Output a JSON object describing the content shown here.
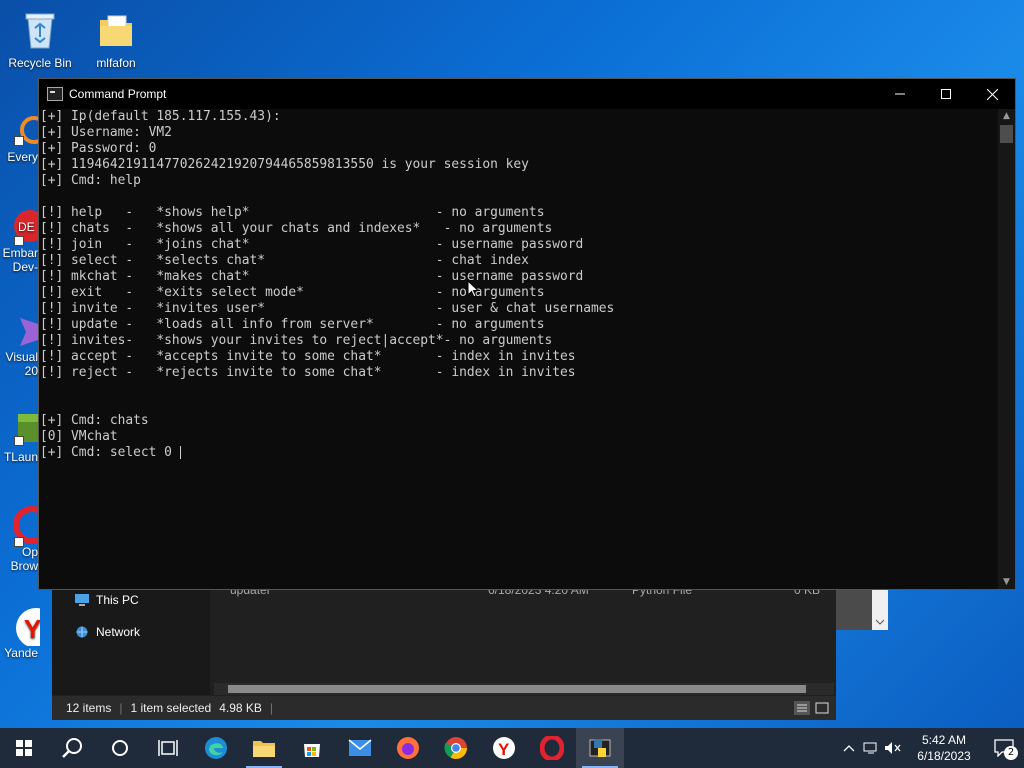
{
  "desktop": {
    "icons": [
      {
        "label": "Recycle Bin",
        "icon": "recycle-bin-icon"
      },
      {
        "label": "mlfafon",
        "icon": "folder-icon"
      }
    ],
    "partial_labels": [
      "Every",
      "Embar",
      "Dev-",
      "Visual",
      "20",
      "TLaun",
      "Op",
      "Brow",
      "Yande"
    ]
  },
  "explorer": {
    "nav": [
      {
        "label": "This PC",
        "icon": "this-pc-icon"
      },
      {
        "label": "Network",
        "icon": "network-icon"
      }
    ],
    "file_row": {
      "name": "updater",
      "date": "6/18/2023 4:20 AM",
      "type": "Python File",
      "size": "0 KB"
    },
    "status": {
      "items": "12 items",
      "selected": "1 item selected",
      "size": "4.98 KB"
    }
  },
  "cmd": {
    "title": "Command Prompt",
    "lines": [
      "[+] Ip(default 185.117.155.43):",
      "[+] Username: VM2",
      "[+] Password: 0",
      "[+] 119464219114770262421920794465859813550 is your session key",
      "[+] Cmd: help",
      "",
      "[!] help   -   *shows help*                        - no arguments",
      "[!] chats  -   *shows all your chats and indexes*   - no arguments",
      "[!] join   -   *joins chat*                        - username password",
      "[!] select -   *selects chat*                      - chat index",
      "[!] mkchat -   *makes chat*                        - username password",
      "[!] exit   -   *exits select mode*                 - no arguments",
      "[!] invite -   *invites user*                      - user & chat usernames",
      "[!] update -   *loads all info from server*        - no arguments",
      "[!] invites-   *shows your invites to reject|accept*- no arguments",
      "[!] accept -   *accepts invite to some chat*       - index in invites",
      "[!] reject -   *rejects invite to some chat*       - index in invites",
      "",
      "",
      "[+] Cmd: chats",
      "[0] VMchat",
      "[+] Cmd: select 0"
    ]
  },
  "taskbar": {
    "apps": [
      "start-icon",
      "search-icon",
      "cortana-icon",
      "task-view-icon",
      "edge-icon",
      "file-explorer-icon",
      "store-icon",
      "mail-icon",
      "firefox-icon",
      "chrome-icon",
      "yandex-icon",
      "opera-icon",
      "python-cmd-icon"
    ],
    "time": "5:42 AM",
    "date": "6/18/2023",
    "notifications": "2"
  },
  "colors": {
    "cmd_bg": "#0c0c0c",
    "cmd_text": "#cccccc",
    "desktop": "#0b6fd6",
    "taskbar": "#1f2a3a"
  }
}
